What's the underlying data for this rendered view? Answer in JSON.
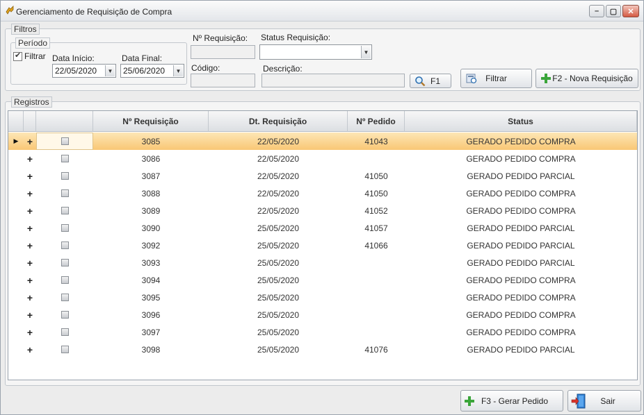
{
  "window": {
    "title": "Gerenciamento de Requisição de Compra"
  },
  "filters": {
    "group_label": "Filtros",
    "period_label": "Período",
    "filter_checkbox_label": "Filtrar",
    "filter_checked": true,
    "start_date_label": "Data Início:",
    "start_date_value": "22/05/2020",
    "end_date_label": "Data Final:",
    "end_date_value": "25/06/2020",
    "req_number_label": "Nº Requisição:",
    "req_number_value": "",
    "status_label": "Status Requisição:",
    "status_value": "",
    "code_label": "Código:",
    "code_value": "",
    "description_label": "Descrição:",
    "description_value": "",
    "f1_button": "F1",
    "filter_button": "Filtrar",
    "new_req_button": "F2 - Nova Requisição"
  },
  "records": {
    "group_label": "Registros",
    "columns": [
      "Nº Requisição",
      "Dt. Requisição",
      "Nº Pedido",
      "Status"
    ],
    "selected_index": 0,
    "rows": [
      {
        "req": "3085",
        "date": "22/05/2020",
        "order": "41043",
        "status": "GERADO PEDIDO COMPRA"
      },
      {
        "req": "3086",
        "date": "22/05/2020",
        "order": "",
        "status": "GERADO PEDIDO COMPRA"
      },
      {
        "req": "3087",
        "date": "22/05/2020",
        "order": "41050",
        "status": "GERADO PEDIDO PARCIAL"
      },
      {
        "req": "3088",
        "date": "22/05/2020",
        "order": "41050",
        "status": "GERADO PEDIDO COMPRA"
      },
      {
        "req": "3089",
        "date": "22/05/2020",
        "order": "41052",
        "status": "GERADO PEDIDO COMPRA"
      },
      {
        "req": "3090",
        "date": "25/05/2020",
        "order": "41057",
        "status": "GERADO PEDIDO PARCIAL"
      },
      {
        "req": "3092",
        "date": "25/05/2020",
        "order": "41066",
        "status": "GERADO PEDIDO PARCIAL"
      },
      {
        "req": "3093",
        "date": "25/05/2020",
        "order": "",
        "status": "GERADO PEDIDO PARCIAL"
      },
      {
        "req": "3094",
        "date": "25/05/2020",
        "order": "",
        "status": "GERADO PEDIDO COMPRA"
      },
      {
        "req": "3095",
        "date": "25/05/2020",
        "order": "",
        "status": "GERADO PEDIDO COMPRA"
      },
      {
        "req": "3096",
        "date": "25/05/2020",
        "order": "",
        "status": "GERADO PEDIDO COMPRA"
      },
      {
        "req": "3097",
        "date": "25/05/2020",
        "order": "",
        "status": "GERADO PEDIDO COMPRA"
      },
      {
        "req": "3098",
        "date": "25/05/2020",
        "order": "41076",
        "status": "GERADO PEDIDO PARCIAL"
      }
    ]
  },
  "footer": {
    "generate_order_button": "F3 - Gerar Pedido",
    "exit_button": "Sair"
  },
  "colors": {
    "selected_row": "#f9c775",
    "add_icon": "#3aa53a",
    "close_button": "#d45a43"
  }
}
